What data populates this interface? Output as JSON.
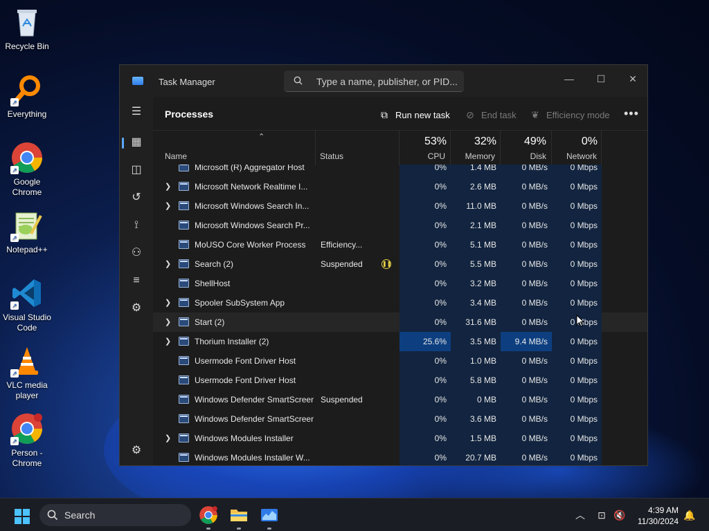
{
  "desktop": {
    "icons": [
      {
        "label": "Recycle Bin",
        "icon": "recycle-bin-icon"
      },
      {
        "label": "Everything",
        "icon": "everything-search-icon"
      },
      {
        "label": "Google Chrome",
        "icon": "chrome-icon"
      },
      {
        "label": "Notepad++",
        "icon": "notepad-plus-plus-icon"
      },
      {
        "label": "Visual Studio Code",
        "icon": "vscode-icon"
      },
      {
        "label": "VLC media player",
        "icon": "vlc-icon"
      },
      {
        "label": "Person - Chrome",
        "icon": "chrome-profile-icon"
      }
    ]
  },
  "window": {
    "title": "Task Manager",
    "search_placeholder": "Type a name, publisher, or PID...",
    "controls": {
      "minimize": "—",
      "maximize": "☐",
      "close": "✕"
    }
  },
  "page": {
    "title": "Processes",
    "commands": {
      "run_new_task": "Run new task",
      "end_task": "End task",
      "efficiency_mode": "Efficiency mode",
      "more": "•••"
    }
  },
  "columns": {
    "name": "Name",
    "status": "Status",
    "cpu_pct": "53%",
    "cpu": "CPU",
    "memory_pct": "32%",
    "memory": "Memory",
    "disk_pct": "49%",
    "disk": "Disk",
    "network_pct": "0%",
    "network": "Network"
  },
  "processes": [
    {
      "name": "Microsoft (R) Aggregator Host",
      "status": "",
      "cpu": "0%",
      "memory": "1.4 MB",
      "disk": "0 MB/s",
      "network": "0 Mbps",
      "expandable": false
    },
    {
      "name": "Microsoft Network Realtime I...",
      "status": "",
      "cpu": "0%",
      "memory": "2.6 MB",
      "disk": "0 MB/s",
      "network": "0 Mbps",
      "expandable": true
    },
    {
      "name": "Microsoft Windows Search In...",
      "status": "",
      "cpu": "0%",
      "memory": "11.0 MB",
      "disk": "0 MB/s",
      "network": "0 Mbps",
      "expandable": true
    },
    {
      "name": "Microsoft Windows Search Pr...",
      "status": "",
      "cpu": "0%",
      "memory": "2.1 MB",
      "disk": "0 MB/s",
      "network": "0 Mbps",
      "expandable": false
    },
    {
      "name": "MoUSO Core Worker Process",
      "status": "Efficiency...",
      "cpu": "0%",
      "memory": "5.1 MB",
      "disk": "0 MB/s",
      "network": "0 Mbps",
      "expandable": false
    },
    {
      "name": "Search (2)",
      "status": "Suspended",
      "cpu": "0%",
      "memory": "5.5 MB",
      "disk": "0 MB/s",
      "network": "0 Mbps",
      "expandable": true,
      "paused": true
    },
    {
      "name": "ShellHost",
      "status": "",
      "cpu": "0%",
      "memory": "3.2 MB",
      "disk": "0 MB/s",
      "network": "0 Mbps",
      "expandable": false
    },
    {
      "name": "Spooler SubSystem App",
      "status": "",
      "cpu": "0%",
      "memory": "3.4 MB",
      "disk": "0 MB/s",
      "network": "0 Mbps",
      "expandable": true
    },
    {
      "name": "Start (2)",
      "status": "",
      "cpu": "0%",
      "memory": "31.6 MB",
      "disk": "0 MB/s",
      "network": "0 Mbps",
      "expandable": true,
      "hover": true
    },
    {
      "name": "Thorium Installer (2)",
      "status": "",
      "cpu": "25.6%",
      "memory": "3.5 MB",
      "disk": "9.4 MB/s",
      "network": "0 Mbps",
      "expandable": true,
      "hot_cpu": true,
      "hot_disk": true
    },
    {
      "name": "Usermode Font Driver Host",
      "status": "",
      "cpu": "0%",
      "memory": "1.0 MB",
      "disk": "0 MB/s",
      "network": "0 Mbps",
      "expandable": false
    },
    {
      "name": "Usermode Font Driver Host",
      "status": "",
      "cpu": "0%",
      "memory": "5.8 MB",
      "disk": "0 MB/s",
      "network": "0 Mbps",
      "expandable": false
    },
    {
      "name": "Windows Defender SmartScreen",
      "status": "Suspended",
      "cpu": "0%",
      "memory": "0 MB",
      "disk": "0 MB/s",
      "network": "0 Mbps",
      "expandable": false
    },
    {
      "name": "Windows Defender SmartScreen",
      "status": "",
      "cpu": "0%",
      "memory": "3.6 MB",
      "disk": "0 MB/s",
      "network": "0 Mbps",
      "expandable": false
    },
    {
      "name": "Windows Modules Installer",
      "status": "",
      "cpu": "0%",
      "memory": "1.5 MB",
      "disk": "0 MB/s",
      "network": "0 Mbps",
      "expandable": true
    },
    {
      "name": "Windows Modules Installer W...",
      "status": "",
      "cpu": "0%",
      "memory": "20.7 MB",
      "disk": "0 MB/s",
      "network": "0 Mbps",
      "expandable": false
    }
  ],
  "taskbar": {
    "search_label": "Search",
    "time": "4:39 AM",
    "date": "11/30/2024"
  },
  "colors": {
    "accent": "#5ca8ff",
    "heat_low": "#12243f",
    "heat_high": "#0d3f80",
    "suspended": "#e8d24a"
  }
}
